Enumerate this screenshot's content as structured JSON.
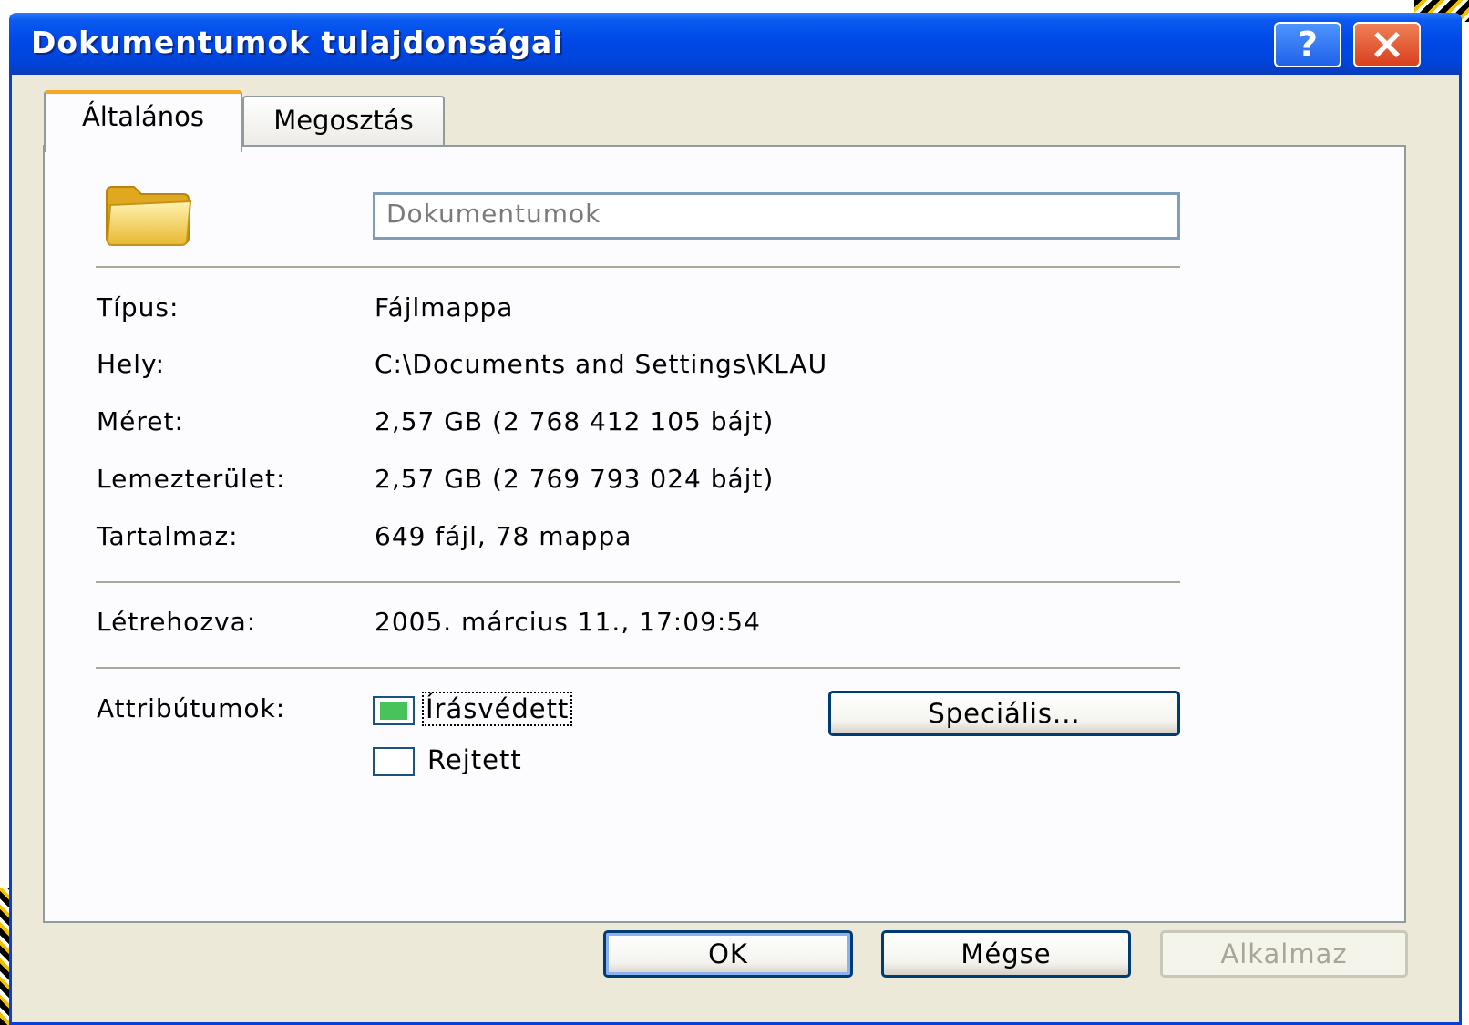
{
  "window": {
    "title": "Dokumentumok tulajdonságai",
    "help_label": "?",
    "close_icon": "close-icon"
  },
  "tabs": [
    {
      "label": "Általános",
      "active": true
    },
    {
      "label": "Megosztás",
      "active": false
    }
  ],
  "general": {
    "folder_icon": "folder-icon",
    "name_value": "Dokumentumok",
    "properties": [
      {
        "label": "Típus:",
        "value": "Fájlmappa"
      },
      {
        "label": "Hely:",
        "value": "C:\\Documents and Settings\\KLAU"
      },
      {
        "label": "Méret:",
        "value": "2,57 GB (2 768 412 105 bájt)"
      },
      {
        "label": "Lemezterület:",
        "value": "2,57 GB (2 769 793 024 bájt)"
      },
      {
        "label": "Tartalmaz:",
        "value": "649 fájl, 78 mappa"
      }
    ],
    "created": {
      "label": "Létrehozva:",
      "value": "2005. március 11., 17:09:54"
    },
    "attributes": {
      "label": "Attribútumok:",
      "readonly": {
        "label": "Írásvédett",
        "checked": true
      },
      "hidden": {
        "label": "Rejtett",
        "checked": false
      },
      "advanced_label": "Speciális..."
    }
  },
  "buttons": {
    "ok": "OK",
    "cancel": "Mégse",
    "apply": "Alkalmaz"
  },
  "colors": {
    "titlebar": "#0048E8",
    "window_bg": "#ECE9D8",
    "tab_accent": "#F5A623",
    "check_fill": "#48C25A"
  }
}
